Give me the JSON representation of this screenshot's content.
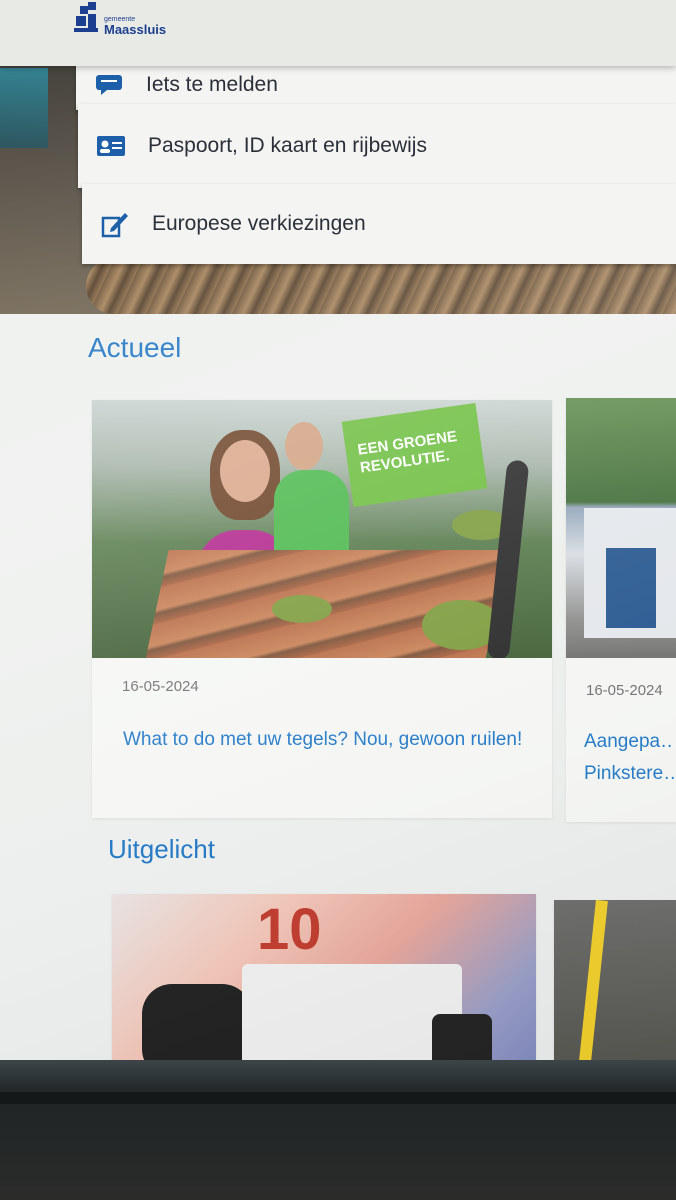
{
  "header": {
    "logo_small": "gemeente",
    "logo_name": "Maassluis",
    "brand_color": "#1d3f8f"
  },
  "quick_links": [
    {
      "label": "Iets te melden",
      "icon": "chat-icon"
    },
    {
      "label": "Paspoort, ID kaart en rijbewijs",
      "icon": "id-card-icon"
    },
    {
      "label": "Europese verkiezingen",
      "icon": "pencil-icon"
    }
  ],
  "actueel": {
    "title": "Actueel",
    "cards": [
      {
        "date": "16-05-2024",
        "title": "What to do met uw tegels? Nou, gewoon ruilen!",
        "image_text": "EEN GROENE REVOLUTIE."
      },
      {
        "date": "16-05-2024",
        "title": "Aangepa… Pinkstere…"
      }
    ]
  },
  "uitgelicht": {
    "title": "Uitgelicht",
    "image_text": "10"
  },
  "colors": {
    "accent_blue": "#1c74c4",
    "link_blue": "#1f78c8",
    "date_gray": "#707070"
  }
}
